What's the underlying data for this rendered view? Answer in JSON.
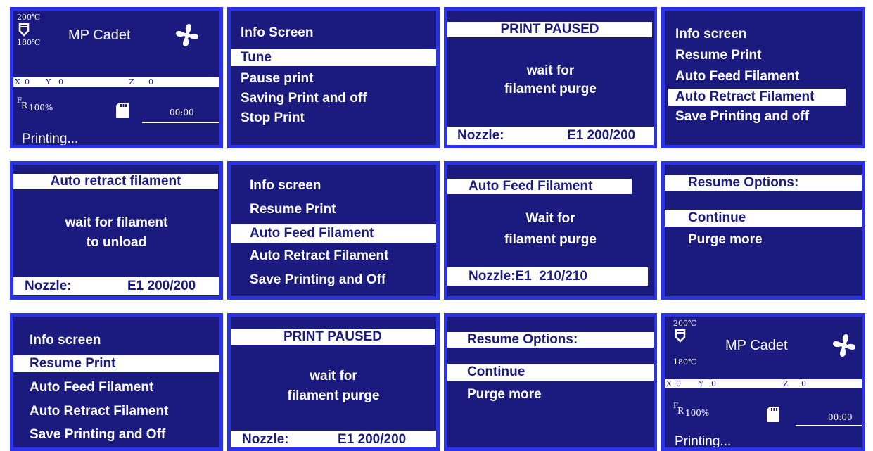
{
  "status1": {
    "temp_top": "200℃",
    "temp_bottom": "180℃",
    "title": "MP Cadet",
    "x_label": "X",
    "x_val": "0",
    "y_label": "Y",
    "y_val": "0",
    "z_label": "Z",
    "z_val": "0",
    "fr_f": "F",
    "fr_r": "R",
    "fr_val": "100%",
    "time": "00:00",
    "status": "Printing..."
  },
  "menu1": {
    "title": "Info Screen",
    "items": [
      "Tune",
      "Pause print",
      "Saving Print and off",
      "Stop Print"
    ]
  },
  "paused1": {
    "title": "PRINT PAUSED",
    "msg1": "wait for",
    "msg2": "filament purge",
    "nozzle_label": "Nozzle:",
    "nozzle_val": "E1 200/200"
  },
  "menu2": {
    "items": [
      "Info screen",
      "Resume Print",
      "Auto Feed Filament",
      "Auto Retract Filament",
      "Save Printing and off"
    ]
  },
  "retract": {
    "title": "Auto retract filament",
    "msg1": "wait for filament",
    "msg2": "to unload",
    "nozzle_label": "Nozzle:",
    "nozzle_val": "E1 200/200"
  },
  "menu3": {
    "items": [
      "Info screen",
      "Resume Print",
      "Auto Feed Filament",
      "Auto Retract Filament",
      "Save Printing and Off"
    ]
  },
  "feed": {
    "title": "Auto Feed Filament",
    "msg1": "Wait for",
    "msg2": "filament purge",
    "nozzle": "Nozzle:E1  210/210"
  },
  "resume1": {
    "title": "Resume Options:",
    "items": [
      "Continue",
      "Purge more"
    ]
  },
  "menu4": {
    "items": [
      "Info screen",
      "Resume Print",
      "Auto Feed Filament",
      "Auto Retract Filament",
      "Save Printing and Off"
    ]
  },
  "paused2": {
    "title": "PRINT PAUSED",
    "msg1": "wait for",
    "msg2": "filament purge",
    "nozzle_label": "Nozzle:",
    "nozzle_val": "E1 200/200"
  },
  "resume2": {
    "title": "Resume Options:",
    "items": [
      "Continue",
      "Purge more"
    ]
  },
  "status2": {
    "temp_top": "200℃",
    "temp_bottom": "180℃",
    "title": "MP Cadet",
    "x_label": "X",
    "x_val": "0",
    "y_label": "Y",
    "y_val": "0",
    "z_label": "Z",
    "z_val": "0",
    "fr_f": "F",
    "fr_r": "R",
    "fr_val": "100%",
    "time": "00:00",
    "status": "Printing..."
  },
  "colors": {
    "screen_bg": "#1b1a7e",
    "screen_border": "#2a33e8",
    "text": "#ffffff"
  }
}
